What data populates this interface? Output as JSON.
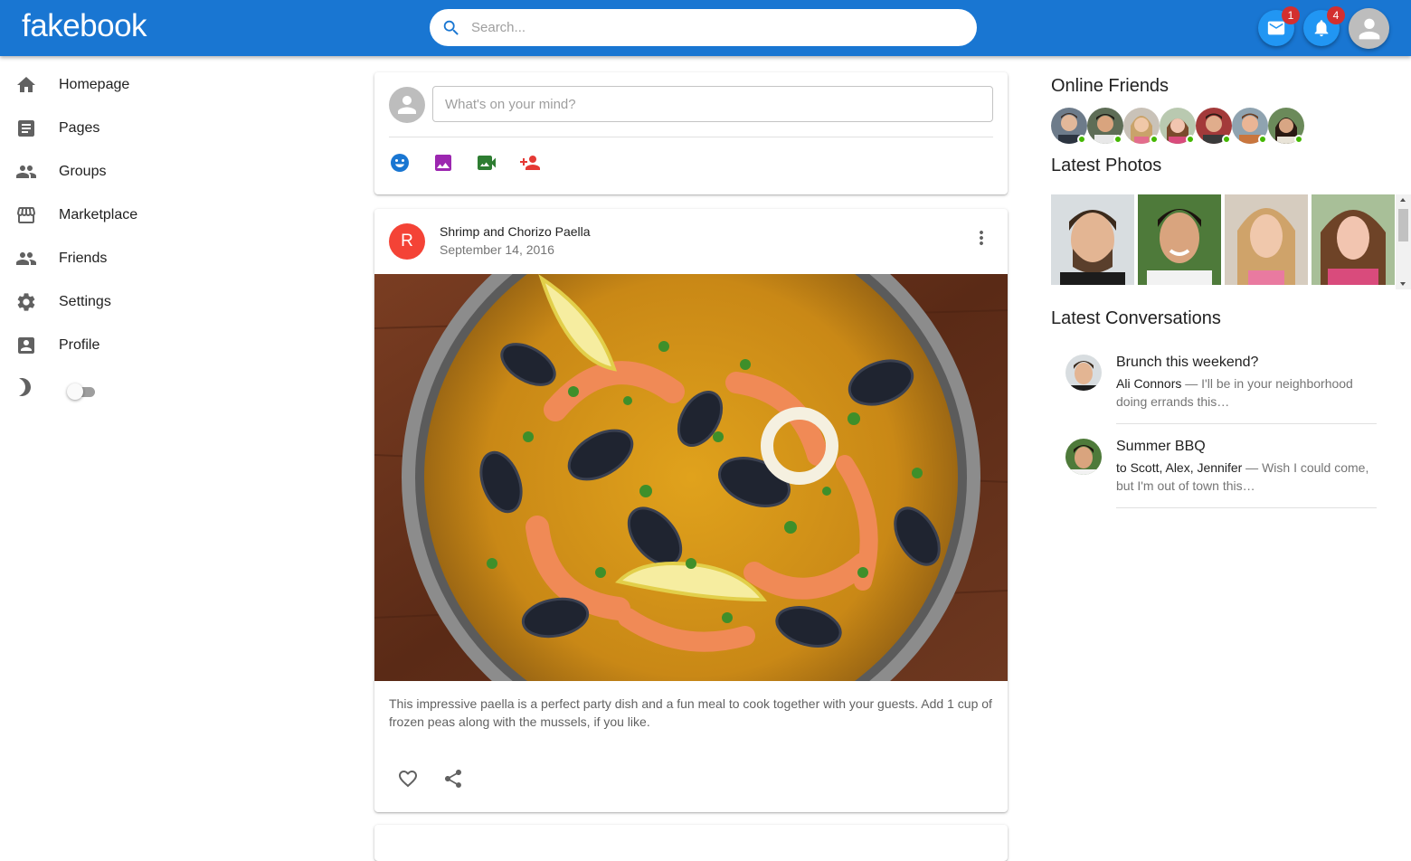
{
  "app": {
    "logo": "fakebook",
    "brand_color": "#1976d2",
    "accent_color": "#2196f3"
  },
  "header": {
    "search_placeholder": "Search...",
    "mail_badge": "1",
    "notifications_badge": "4",
    "icons": [
      "search-icon",
      "mail-icon",
      "notifications-icon",
      "account-icon"
    ]
  },
  "sidebar": {
    "items": [
      {
        "label": "Homepage",
        "icon": "home-icon"
      },
      {
        "label": "Pages",
        "icon": "article-icon"
      },
      {
        "label": "Groups",
        "icon": "people-icon"
      },
      {
        "label": "Marketplace",
        "icon": "store-icon"
      },
      {
        "label": "Friends",
        "icon": "people-icon"
      },
      {
        "label": "Settings",
        "icon": "gear-icon"
      },
      {
        "label": "Profile",
        "icon": "account-box-icon"
      }
    ],
    "dark_mode": {
      "icon": "moon-icon",
      "enabled": false
    }
  },
  "composer": {
    "placeholder": "What's on your mind?",
    "actions": [
      "emoji-icon",
      "photo-icon",
      "video-icon",
      "add-person-icon"
    ]
  },
  "post": {
    "avatar_letter": "R",
    "title": "Shrimp and Chorizo Paella",
    "date": "September 14, 2016",
    "description": "This impressive paella is a perfect party dish and a fun meal to cook together with your guests. Add 1 cup of frozen peas along with the mussels, if you like."
  },
  "right": {
    "online_title": "Online Friends",
    "online_friend_count": 7,
    "photos_title": "Latest Photos",
    "conversations_title": "Latest Conversations",
    "conversations": [
      {
        "title": "Brunch this weekend?",
        "who": "Ali Connors",
        "text": " — I'll be in your neighborhood doing errands this…"
      },
      {
        "title": "Summer BBQ",
        "who": "to Scott, Alex, Jennifer",
        "text": " — Wish I could come, but I'm out of town this…"
      }
    ]
  }
}
